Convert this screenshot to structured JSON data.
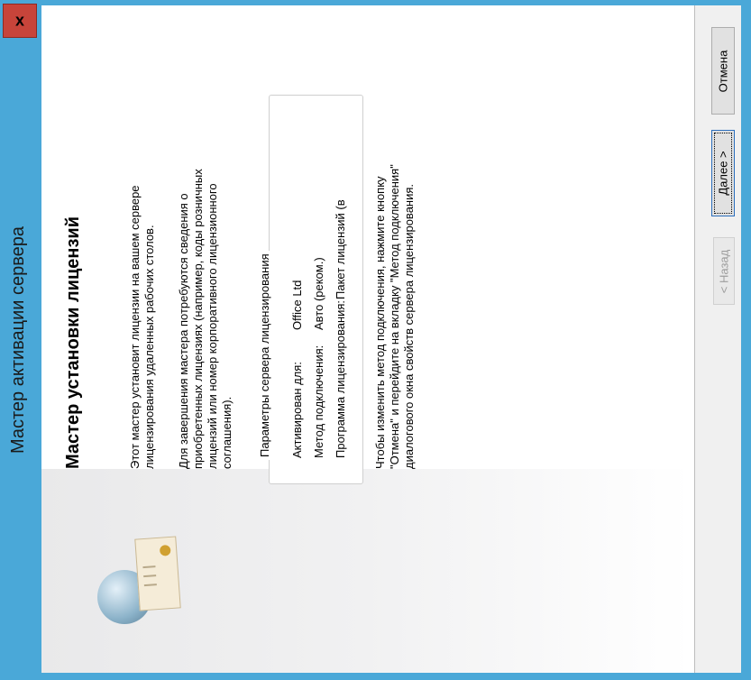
{
  "window": {
    "title": "Мастер активации сервера",
    "close_glyph": "x"
  },
  "content": {
    "heading": "Мастер установки лицензий",
    "intro_line1": "Этот мастер установит лицензии на вашем сервере",
    "intro_line2": "лицензирования удаленных рабочих столов.",
    "info_line1": "Для завершения мастера потребуются сведения о",
    "info_line2": "приобретенных лицензиях (например, коды розничных",
    "info_line3": "лицензий или номер корпоративного лицензионного",
    "info_line4": "соглашения).",
    "group_title": "Параметры сервера лицензирования",
    "params": [
      {
        "label": "Активирован для:",
        "value": "Office Ltd"
      },
      {
        "label": "Метод подключения:",
        "value": "Авто (реком.)"
      },
      {
        "label": "Программа лицензирования:",
        "value": "Пакет лицензий (в"
      }
    ],
    "note_line1": "Чтобы изменить метод подключения, нажмите кнопку",
    "note_line2": "\"Отмена\" и перейдите на вкладку \"Метод подключения\"",
    "note_line3": "диалогового окна свойств сервера лицензирования."
  },
  "buttons": {
    "back": "< Назад",
    "next": "Далее >",
    "cancel": "Отмена"
  },
  "icons": {
    "close": "close-icon",
    "globe": "globe-icon",
    "certificate": "certificate-icon"
  }
}
